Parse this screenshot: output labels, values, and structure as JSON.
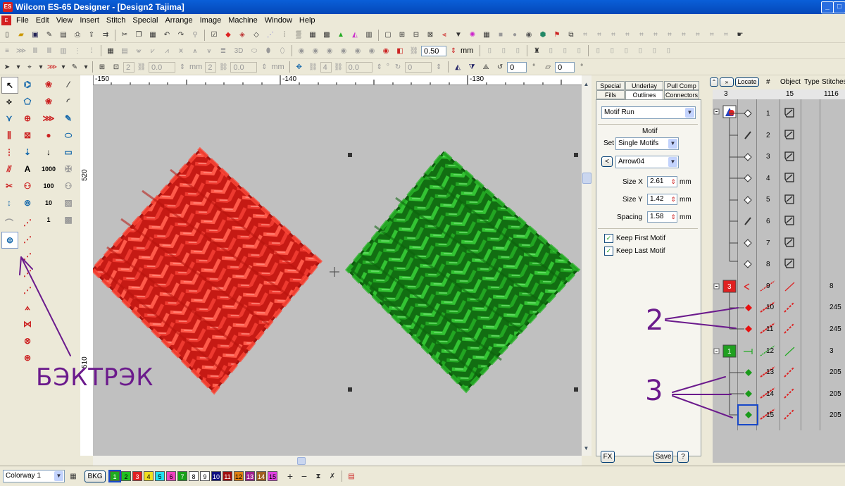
{
  "window": {
    "title": "Wilcom ES-65 Designer - [Design2        Tajima]",
    "logo": "ES"
  },
  "menu": [
    "File",
    "Edit",
    "View",
    "Insert",
    "Stitch",
    "Special",
    "Arrange",
    "Image",
    "Machine",
    "Window",
    "Help"
  ],
  "toolbar2": {
    "spacing_value": "0.50",
    "unit": "mm"
  },
  "toolbar3": {
    "f1": "2",
    "f2": "0.0",
    "u1": "mm",
    "f3": "2",
    "f4": "0.0",
    "u2": "mm",
    "f5": "4",
    "f6": "0.0",
    "f7": "0",
    "u3": "°",
    "f8": "0",
    "f9": "0"
  },
  "ruler": {
    "top": [
      "-150",
      "-140",
      "-130"
    ],
    "left": [
      "520",
      "510"
    ]
  },
  "props": {
    "tabs": [
      "Special",
      "Underlay",
      "Pull Comp",
      "Fills",
      "Outlines",
      "Connectors"
    ],
    "active_tab": "Outlines",
    "stitch_type": "Motif Run",
    "section": "Motif",
    "set_label": "Set",
    "set_value": "Single Motifs",
    "motif_value": "Arrow04",
    "sizex_label": "Size X",
    "sizex_value": "2.61",
    "sizey_label": "Size Y",
    "sizey_value": "1.42",
    "spacing_label": "Spacing",
    "spacing_value": "1.58",
    "unit": "mm",
    "keep_first": "Keep First Motif",
    "keep_last": "Keep Last Motif",
    "fx_label": "FX",
    "save_label": "Save",
    "help_label": "?"
  },
  "sequence": {
    "locate_label": "Locate",
    "columns": [
      "#",
      "Object",
      "Type",
      "Stitches"
    ],
    "summary": {
      "colors": "3",
      "objects": "15",
      "stitches": "1116"
    },
    "groups": [
      {
        "label": "3",
        "color": "#e02020"
      },
      {
        "label": "1",
        "color": "#20a020"
      }
    ],
    "rows": [
      {
        "n": "1",
        "stitches": ""
      },
      {
        "n": "2",
        "stitches": ""
      },
      {
        "n": "3",
        "stitches": ""
      },
      {
        "n": "4",
        "stitches": ""
      },
      {
        "n": "5",
        "stitches": ""
      },
      {
        "n": "6",
        "stitches": ""
      },
      {
        "n": "7",
        "stitches": ""
      },
      {
        "n": "8",
        "stitches": ""
      },
      {
        "n": "9",
        "stitches": "8"
      },
      {
        "n": "10",
        "stitches": "245"
      },
      {
        "n": "11",
        "stitches": "245"
      },
      {
        "n": "12",
        "stitches": "3"
      },
      {
        "n": "13",
        "stitches": "205"
      },
      {
        "n": "14",
        "stitches": "205"
      },
      {
        "n": "15",
        "stitches": "205"
      }
    ]
  },
  "status": {
    "colorway": "Colorway 1",
    "bkg": "BKG",
    "colors": [
      {
        "n": "1",
        "c": "#1faa1f"
      },
      {
        "n": "2",
        "c": "#20c020"
      },
      {
        "n": "3",
        "c": "#e02020"
      },
      {
        "n": "4",
        "c": "#f0e020"
      },
      {
        "n": "5",
        "c": "#20e0f0"
      },
      {
        "n": "6",
        "c": "#f040c0"
      },
      {
        "n": "7",
        "c": "#18a018"
      },
      {
        "n": "8",
        "c": "#ffffff"
      },
      {
        "n": "9",
        "c": "#ffffff"
      },
      {
        "n": "10",
        "c": "#101080"
      },
      {
        "n": "11",
        "c": "#a01010"
      },
      {
        "n": "12",
        "c": "#e08010"
      },
      {
        "n": "13",
        "c": "#a02090"
      },
      {
        "n": "14",
        "c": "#a06020"
      },
      {
        "n": "15",
        "c": "#e040e0"
      }
    ]
  },
  "annotations": {
    "label1": "БЭКТРЭК",
    "label2": "2",
    "label3": "3"
  },
  "colors": {
    "red": "#e03228",
    "green": "#1f9a20",
    "selection": "#1848c8"
  }
}
